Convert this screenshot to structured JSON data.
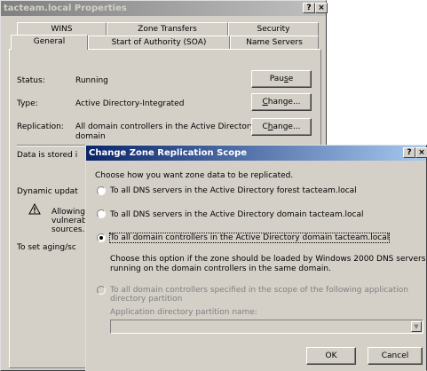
{
  "props": {
    "title": "tacteam.local Properties",
    "help_btn": "?",
    "close_btn": "×",
    "tabs_upper": [
      "WINS",
      "Zone Transfers",
      "Security"
    ],
    "tabs_lower": [
      "General",
      "Start of Authority (SOA)",
      "Name Servers"
    ],
    "status_label": "Status:",
    "status_value": "Running",
    "pause_btn": "Pause",
    "type_label": "Type:",
    "type_value": "Active Directory-Integrated",
    "change_btn": "Change...",
    "replication_label": "Replication:",
    "replication_value_line1": "All domain controllers in the Active Directory",
    "replication_value_line2": "domain",
    "data_stored": "Data is stored i",
    "dynamic_updates": "Dynamic updat",
    "warning_line1": "Allowing",
    "warning_line2": "vulnerab",
    "warning_line3": "sources.",
    "aging": "To set aging/sc",
    "warning_icon": "warning-triangle"
  },
  "dialog": {
    "title": "Change Zone Replication Scope",
    "help_btn": "?",
    "close_btn": "×",
    "prompt": "Choose how you want zone data to be replicated.",
    "options": [
      {
        "label": "To all DNS servers in the Active Directory forest tacteam.local",
        "selected": false,
        "enabled": true
      },
      {
        "label": "To all DNS servers in the Active Directory domain tacteam.local",
        "selected": false,
        "enabled": true
      },
      {
        "label": "To all domain controllers in the Active Directory domain tacteam.local",
        "selected": true,
        "enabled": true
      },
      {
        "label_line1": "To all domain controllers specified in the scope of the following application",
        "label_line2": "directory partition",
        "selected": false,
        "enabled": false
      }
    ],
    "description_line1": "Choose this option if the zone should be loaded by Windows 2000 DNS servers",
    "description_line2": "running on the domain controllers in the same domain.",
    "partition_label": "Application directory partition name:",
    "partition_value": "",
    "ok_btn": "OK",
    "cancel_btn": "Cancel"
  }
}
